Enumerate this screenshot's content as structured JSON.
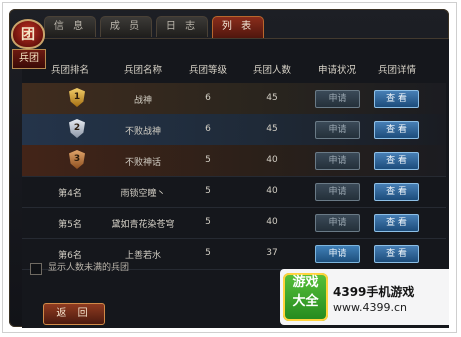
{
  "tabs": [
    "信 息",
    "成 员",
    "日 志",
    "列 表"
  ],
  "emblem": {
    "glyph": "团",
    "label": "兵团"
  },
  "table": {
    "headers": [
      "兵团排名",
      "兵团名称",
      "兵团等级",
      "兵团人数",
      "申请状况",
      "兵团详情"
    ],
    "rows": [
      {
        "rank": "1",
        "name": "战神",
        "level": "6",
        "members": "45",
        "apply": "申请",
        "detail": "查 看"
      },
      {
        "rank": "2",
        "name": "不败战神",
        "level": "6",
        "members": "45",
        "apply": "申请",
        "detail": "查 看"
      },
      {
        "rank": "3",
        "name": "不败神话",
        "level": "5",
        "members": "40",
        "apply": "申请",
        "detail": "查 看"
      },
      {
        "rank": "第4名",
        "name": "雨锁空瞳丶",
        "level": "5",
        "members": "40",
        "apply": "申请",
        "detail": "查 看"
      },
      {
        "rank": "第5名",
        "name": "黛如青花染苍穹",
        "level": "5",
        "members": "40",
        "apply": "申请",
        "detail": "查 看"
      },
      {
        "rank": "第6名",
        "name": "上善若水",
        "level": "5",
        "members": "37",
        "apply": "申请",
        "detail": "查 看"
      }
    ]
  },
  "checkbox_label": "显示人数未满的兵团",
  "back_label": "返 回",
  "watermark": {
    "box_top": "游戏",
    "box_bottom": "大全",
    "line1": "4399手机游戏",
    "line2": "www.4399.cn"
  }
}
